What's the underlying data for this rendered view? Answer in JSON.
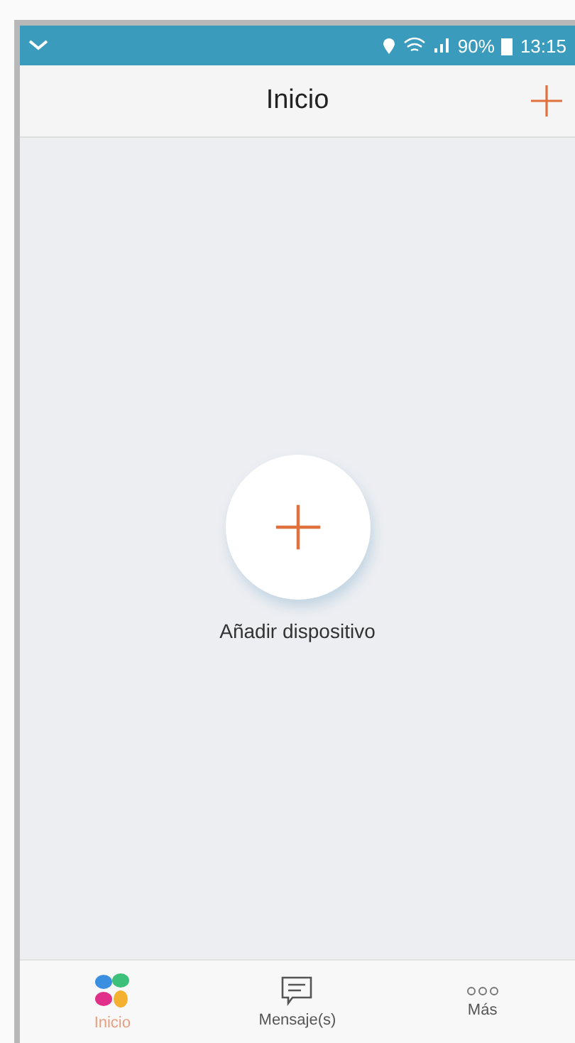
{
  "status_bar": {
    "battery": "90%",
    "time": "13:15"
  },
  "header": {
    "title": "Inicio"
  },
  "empty_state": {
    "label": "Añadir dispositivo"
  },
  "tabs": [
    {
      "label": "Inicio",
      "kind": "home",
      "selected": true
    },
    {
      "label": "Mensaje(s)",
      "kind": "messages",
      "selected": false
    },
    {
      "label": "Más",
      "kind": "more",
      "selected": false
    }
  ]
}
